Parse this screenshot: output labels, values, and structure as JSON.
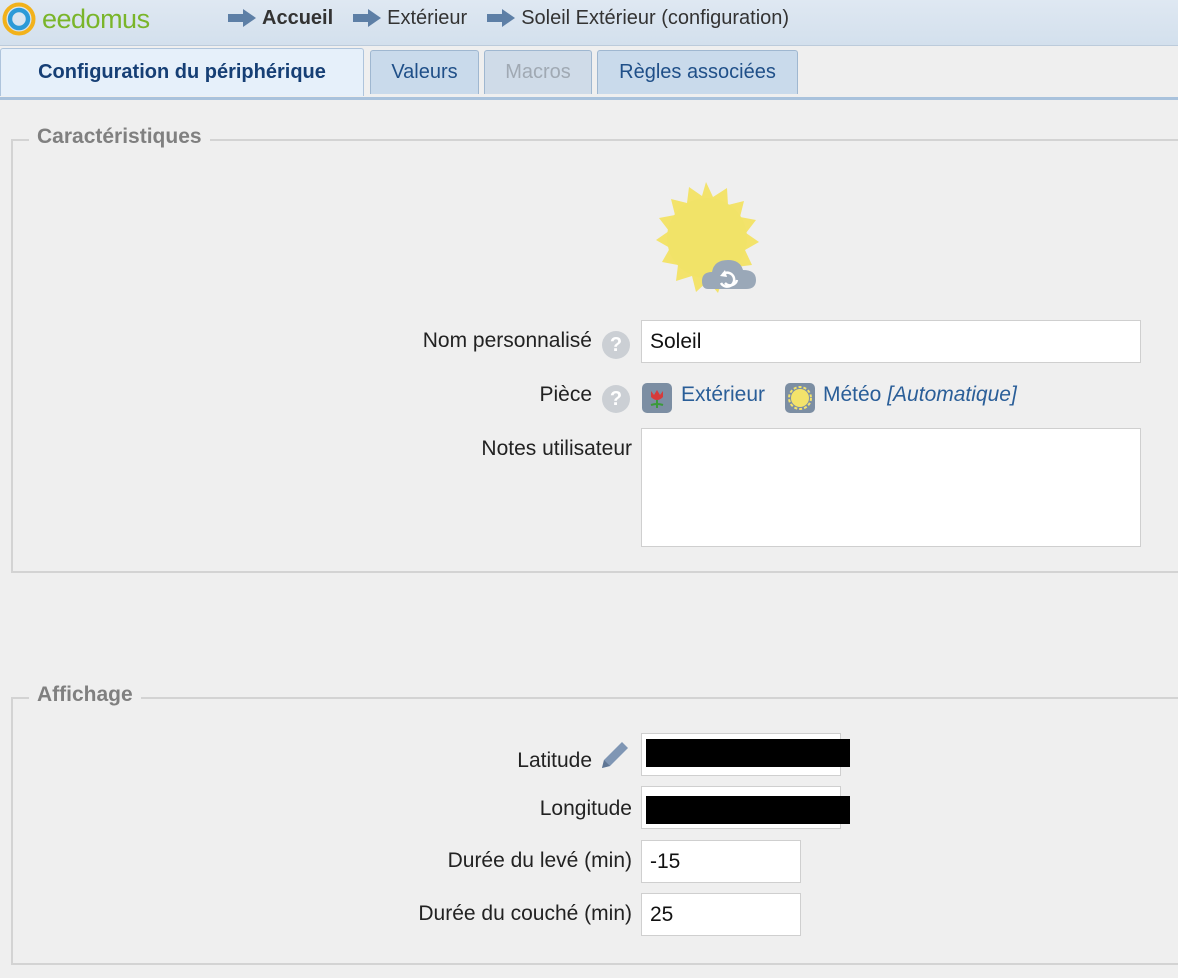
{
  "app": {
    "logo_text": "eedomus"
  },
  "breadcrumb": [
    {
      "label": "Accueil"
    },
    {
      "label": "Extérieur"
    },
    {
      "label": "Soleil Extérieur (configuration)"
    }
  ],
  "tabs": [
    {
      "label": "Configuration du périphérique",
      "state": "active"
    },
    {
      "label": "Valeurs",
      "state": "normal"
    },
    {
      "label": "Macros",
      "state": "disabled"
    },
    {
      "label": "Règles associées",
      "state": "normal"
    }
  ],
  "characteristics": {
    "legend": "Caractéristiques",
    "name_label": "Nom personnalisé",
    "name_value": "Soleil",
    "room_label": "Pièce",
    "room_link": "Extérieur",
    "category_link": "Météo",
    "category_mode": "[Automatique]",
    "notes_label": "Notes utilisateur",
    "notes_value": ""
  },
  "display": {
    "legend": "Affichage",
    "latitude_label": "Latitude",
    "longitude_label": "Longitude",
    "sunrise_label": "Durée du levé (min)",
    "sunrise_value": "-15",
    "sunset_label": "Durée du couché (min)",
    "sunset_value": "25"
  },
  "colors": {
    "accent": "#2a5e98",
    "logo_green": "#7ab52a",
    "sun": "#f3e36b"
  }
}
